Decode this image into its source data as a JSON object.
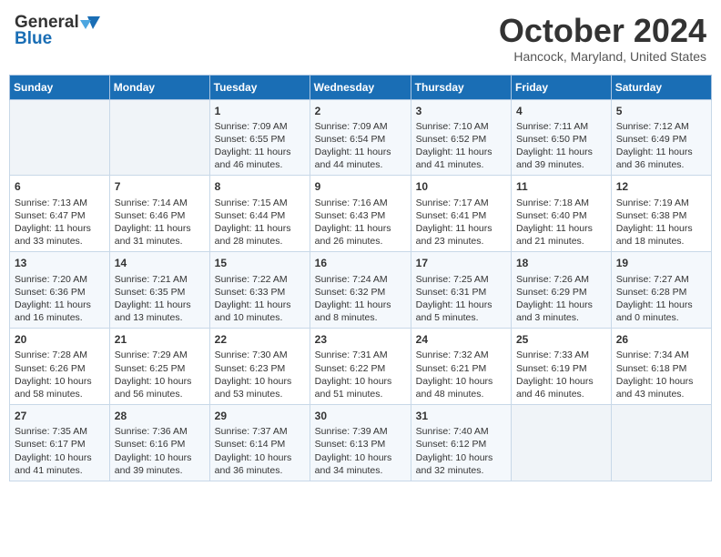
{
  "header": {
    "logo_general": "General",
    "logo_blue": "Blue",
    "month_title": "October 2024",
    "location": "Hancock, Maryland, United States"
  },
  "weekdays": [
    "Sunday",
    "Monday",
    "Tuesday",
    "Wednesday",
    "Thursday",
    "Friday",
    "Saturday"
  ],
  "weeks": [
    [
      {
        "day": "",
        "info": ""
      },
      {
        "day": "",
        "info": ""
      },
      {
        "day": "1",
        "info": "Sunrise: 7:09 AM\nSunset: 6:55 PM\nDaylight: 11 hours and 46 minutes."
      },
      {
        "day": "2",
        "info": "Sunrise: 7:09 AM\nSunset: 6:54 PM\nDaylight: 11 hours and 44 minutes."
      },
      {
        "day": "3",
        "info": "Sunrise: 7:10 AM\nSunset: 6:52 PM\nDaylight: 11 hours and 41 minutes."
      },
      {
        "day": "4",
        "info": "Sunrise: 7:11 AM\nSunset: 6:50 PM\nDaylight: 11 hours and 39 minutes."
      },
      {
        "day": "5",
        "info": "Sunrise: 7:12 AM\nSunset: 6:49 PM\nDaylight: 11 hours and 36 minutes."
      }
    ],
    [
      {
        "day": "6",
        "info": "Sunrise: 7:13 AM\nSunset: 6:47 PM\nDaylight: 11 hours and 33 minutes."
      },
      {
        "day": "7",
        "info": "Sunrise: 7:14 AM\nSunset: 6:46 PM\nDaylight: 11 hours and 31 minutes."
      },
      {
        "day": "8",
        "info": "Sunrise: 7:15 AM\nSunset: 6:44 PM\nDaylight: 11 hours and 28 minutes."
      },
      {
        "day": "9",
        "info": "Sunrise: 7:16 AM\nSunset: 6:43 PM\nDaylight: 11 hours and 26 minutes."
      },
      {
        "day": "10",
        "info": "Sunrise: 7:17 AM\nSunset: 6:41 PM\nDaylight: 11 hours and 23 minutes."
      },
      {
        "day": "11",
        "info": "Sunrise: 7:18 AM\nSunset: 6:40 PM\nDaylight: 11 hours and 21 minutes."
      },
      {
        "day": "12",
        "info": "Sunrise: 7:19 AM\nSunset: 6:38 PM\nDaylight: 11 hours and 18 minutes."
      }
    ],
    [
      {
        "day": "13",
        "info": "Sunrise: 7:20 AM\nSunset: 6:36 PM\nDaylight: 11 hours and 16 minutes."
      },
      {
        "day": "14",
        "info": "Sunrise: 7:21 AM\nSunset: 6:35 PM\nDaylight: 11 hours and 13 minutes."
      },
      {
        "day": "15",
        "info": "Sunrise: 7:22 AM\nSunset: 6:33 PM\nDaylight: 11 hours and 10 minutes."
      },
      {
        "day": "16",
        "info": "Sunrise: 7:24 AM\nSunset: 6:32 PM\nDaylight: 11 hours and 8 minutes."
      },
      {
        "day": "17",
        "info": "Sunrise: 7:25 AM\nSunset: 6:31 PM\nDaylight: 11 hours and 5 minutes."
      },
      {
        "day": "18",
        "info": "Sunrise: 7:26 AM\nSunset: 6:29 PM\nDaylight: 11 hours and 3 minutes."
      },
      {
        "day": "19",
        "info": "Sunrise: 7:27 AM\nSunset: 6:28 PM\nDaylight: 11 hours and 0 minutes."
      }
    ],
    [
      {
        "day": "20",
        "info": "Sunrise: 7:28 AM\nSunset: 6:26 PM\nDaylight: 10 hours and 58 minutes."
      },
      {
        "day": "21",
        "info": "Sunrise: 7:29 AM\nSunset: 6:25 PM\nDaylight: 10 hours and 56 minutes."
      },
      {
        "day": "22",
        "info": "Sunrise: 7:30 AM\nSunset: 6:23 PM\nDaylight: 10 hours and 53 minutes."
      },
      {
        "day": "23",
        "info": "Sunrise: 7:31 AM\nSunset: 6:22 PM\nDaylight: 10 hours and 51 minutes."
      },
      {
        "day": "24",
        "info": "Sunrise: 7:32 AM\nSunset: 6:21 PM\nDaylight: 10 hours and 48 minutes."
      },
      {
        "day": "25",
        "info": "Sunrise: 7:33 AM\nSunset: 6:19 PM\nDaylight: 10 hours and 46 minutes."
      },
      {
        "day": "26",
        "info": "Sunrise: 7:34 AM\nSunset: 6:18 PM\nDaylight: 10 hours and 43 minutes."
      }
    ],
    [
      {
        "day": "27",
        "info": "Sunrise: 7:35 AM\nSunset: 6:17 PM\nDaylight: 10 hours and 41 minutes."
      },
      {
        "day": "28",
        "info": "Sunrise: 7:36 AM\nSunset: 6:16 PM\nDaylight: 10 hours and 39 minutes."
      },
      {
        "day": "29",
        "info": "Sunrise: 7:37 AM\nSunset: 6:14 PM\nDaylight: 10 hours and 36 minutes."
      },
      {
        "day": "30",
        "info": "Sunrise: 7:39 AM\nSunset: 6:13 PM\nDaylight: 10 hours and 34 minutes."
      },
      {
        "day": "31",
        "info": "Sunrise: 7:40 AM\nSunset: 6:12 PM\nDaylight: 10 hours and 32 minutes."
      },
      {
        "day": "",
        "info": ""
      },
      {
        "day": "",
        "info": ""
      }
    ]
  ]
}
